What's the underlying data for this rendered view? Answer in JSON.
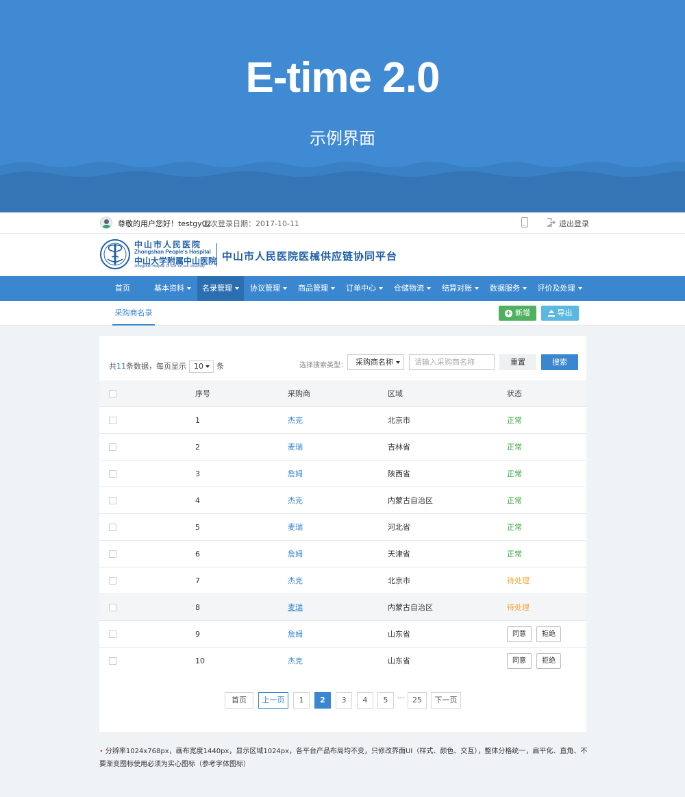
{
  "banner": {
    "title": "E-time 2.0",
    "subtitle": "示例界面"
  },
  "topbar": {
    "greeting": "尊敬的用户您好！testgy02",
    "last_login": "上次登录日期：2017-10-11",
    "logout": "退出登录"
  },
  "header": {
    "logo_cn_1": "中山市人民医院",
    "logo_en_1": "Zhongshan People's Hospital",
    "logo_cn_2": "中山大学附属中山医院",
    "logo_en_2": "Zhongshan Hospital Of Sun Yat-sen University",
    "platform": "中山市人民医院医械供应链协同平台"
  },
  "nav": {
    "items": [
      {
        "label": "首页"
      },
      {
        "label": "基本资料"
      },
      {
        "label": "名录管理"
      },
      {
        "label": "协议管理"
      },
      {
        "label": "商品管理"
      },
      {
        "label": "订单中心"
      },
      {
        "label": "仓储物流"
      },
      {
        "label": "结算对账"
      },
      {
        "label": "数据服务"
      },
      {
        "label": "评价及处理"
      }
    ]
  },
  "subbar": {
    "tab": "采购商名录",
    "add_label": "新增",
    "export_label": "导出"
  },
  "toolbar": {
    "total_prefix": "共",
    "total_count": "11",
    "total_suffix": "条数据，每页显示",
    "page_size": "10",
    "page_size_unit": "条",
    "search_label": "选择搜索类型：",
    "search_type": "采购商名称",
    "search_placeholder": "请输入采购商名称",
    "reset_label": "重置",
    "search_button": "搜索"
  },
  "table": {
    "headers": [
      "序号",
      "采购商",
      "区域",
      "状态"
    ],
    "rows": [
      {
        "idx": "1",
        "buyer": "杰克",
        "region": "北京市",
        "status": "正常"
      },
      {
        "idx": "2",
        "buyer": "麦瑞",
        "region": "吉林省",
        "status": "正常"
      },
      {
        "idx": "3",
        "buyer": "詹姆",
        "region": "陕西省",
        "status": "正常"
      },
      {
        "idx": "4",
        "buyer": "杰克",
        "region": "内蒙古自治区",
        "status": "正常"
      },
      {
        "idx": "5",
        "buyer": "麦瑞",
        "region": "河北省",
        "status": "正常"
      },
      {
        "idx": "6",
        "buyer": "詹姆",
        "region": "天津省",
        "status": "正常"
      },
      {
        "idx": "7",
        "buyer": "杰克",
        "region": "北京市",
        "status": "待处理"
      },
      {
        "idx": "8",
        "buyer": "麦瑞",
        "region": "内蒙古自治区",
        "status": "待处理"
      },
      {
        "idx": "9",
        "buyer": "詹姆",
        "region": "山东省",
        "agree": "同意",
        "reject": "拒绝"
      },
      {
        "idx": "10",
        "buyer": "杰克",
        "region": "山东省",
        "agree": "同意",
        "reject": "拒绝"
      }
    ]
  },
  "pager": {
    "first": "首页",
    "prev": "上一页",
    "pages": [
      "1",
      "2",
      "3",
      "4",
      "5"
    ],
    "current": "2",
    "ellipsis": "···",
    "last": "25",
    "next": "下一页"
  },
  "footnote": {
    "text": "分辨率1024x768px，画布宽度1440px，显示区域1024px，各平台产品布局均不变，只修改界面UI（样式、颜色、交互），整体分格统一，扁平化、直角、不要渐变图标使用必须为实心图标（参考字体图标）"
  },
  "colors": {
    "banner": "#3f8ad2",
    "primary": "#3a87cf",
    "nav_active": "#2b6fb1",
    "success": "#4fb160",
    "status_ok": "#3aa845",
    "status_pending": "#f0a63a"
  }
}
